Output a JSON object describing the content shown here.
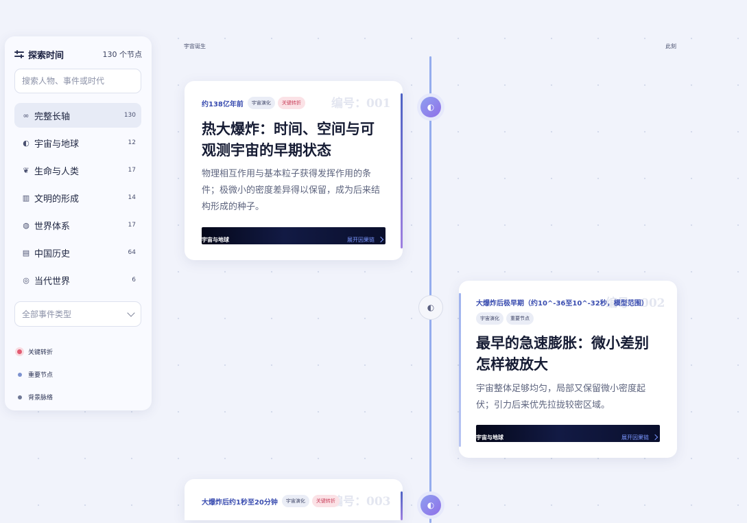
{
  "sidebar": {
    "title": "探索时间",
    "count": "130 个节点",
    "search_placeholder": "搜索人物、事件或时代",
    "items": [
      {
        "label": "完整长轴",
        "count": "130",
        "icon": "infinity-icon",
        "glyph": "∞"
      },
      {
        "label": "宇宙与地球",
        "count": "12",
        "icon": "planet-icon",
        "glyph": "◐"
      },
      {
        "label": "生命与人类",
        "count": "17",
        "icon": "leaf-icon",
        "glyph": "❦"
      },
      {
        "label": "文明的形成",
        "count": "14",
        "icon": "building-icon",
        "glyph": "▥"
      },
      {
        "label": "世界体系",
        "count": "17",
        "icon": "globe-icon",
        "glyph": "◍"
      },
      {
        "label": "中国历史",
        "count": "64",
        "icon": "book-icon",
        "glyph": "▤"
      },
      {
        "label": "当代世界",
        "count": "6",
        "icon": "target-icon",
        "glyph": "◎"
      }
    ],
    "filter_label": "全部事件类型",
    "legend": [
      {
        "label": "关键转折",
        "color": "#e25b72"
      },
      {
        "label": "重要节点",
        "color": "#7d92cf"
      },
      {
        "label": "背景脉络",
        "color": "#6f7896"
      }
    ]
  },
  "timeline": {
    "start_label": "宇宙诞生",
    "end_label": "此刻",
    "events": [
      {
        "era": "约138亿年前",
        "tags": [
          "宇宙演化",
          "关键转折"
        ],
        "number": "编号：001",
        "title": "热大爆炸：时间、空间与可观测宇宙的早期状态",
        "desc": "物理相互作用与基本粒子获得发挥作用的条件；极微小的密度差异得以保留，成为后来结构形成的种子。",
        "category": "宇宙与地球",
        "link": "展开因果链"
      },
      {
        "era": "大爆炸后极早期（约10^-36至10^-32秒，模型范围）",
        "tags": [
          "宇宙演化",
          "重要节点"
        ],
        "number": "编号：002",
        "title": "最早的急速膨胀：微小差别怎样被放大",
        "desc": "宇宙整体足够均匀，局部又保留微小密度起伏；引力后来优先拉拢较密区域。",
        "category": "宇宙与地球",
        "link": "展开因果链"
      },
      {
        "era": "大爆炸后约1秒至20分钟",
        "tags": [
          "宇宙演化",
          "关键转折"
        ],
        "number": "编号：003"
      }
    ]
  }
}
